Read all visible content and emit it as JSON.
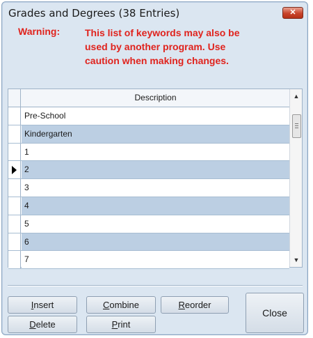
{
  "window": {
    "title": "Grades and Degrees (38 Entries)",
    "close_glyph": "✕"
  },
  "warning": {
    "label": "Warning:",
    "lines": [
      "This list of keywords may also be",
      "used by another program. Use",
      "caution when making changes."
    ],
    "color": "#e0231d"
  },
  "grid": {
    "column_header": "Description",
    "rows": [
      {
        "value": "Pre-School"
      },
      {
        "value": "Kindergarten"
      },
      {
        "value": "1"
      },
      {
        "value": "2"
      },
      {
        "value": "3"
      },
      {
        "value": "4"
      },
      {
        "value": "5"
      },
      {
        "value": "6"
      },
      {
        "value": "7"
      }
    ],
    "selected_row_index": 3,
    "alt_row_color": "#bccfe3"
  },
  "scrollbar": {
    "up_glyph": "▲",
    "down_glyph": "▼"
  },
  "buttons": {
    "insert": {
      "key": "I",
      "rest": "nsert"
    },
    "combine": {
      "key": "C",
      "rest": "ombine"
    },
    "reorder": {
      "key": "R",
      "rest": "eorder"
    },
    "delete": {
      "key": "D",
      "rest": "elete"
    },
    "print": {
      "key": "P",
      "rest": "rint"
    },
    "close": {
      "label": "Close"
    }
  }
}
